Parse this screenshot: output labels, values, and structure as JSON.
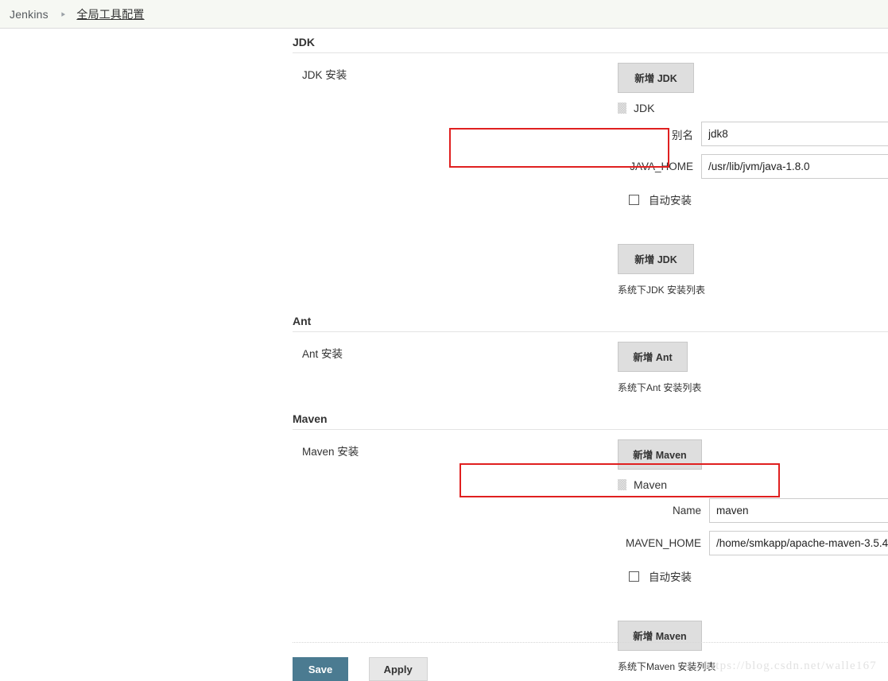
{
  "breadcrumb": {
    "root": "Jenkins",
    "separator": "▸",
    "current": "全局工具配置"
  },
  "sections": {
    "jdk": {
      "title": "JDK",
      "row_label": "JDK 安装",
      "add_button_top": "新增 JDK",
      "tool_name": "JDK",
      "alias_label": "别名",
      "alias_value": "jdk8",
      "home_label": "JAVA_HOME",
      "home_value": "/usr/lib/jvm/java-1.8.0",
      "auto_install_label": "自动安装",
      "add_button_bottom": "新增 JDK",
      "helper_text": "系统下JDK 安装列表"
    },
    "ant": {
      "title": "Ant",
      "row_label": "Ant 安装",
      "add_button": "新增 Ant",
      "helper_text": "系统下Ant 安装列表"
    },
    "maven": {
      "title": "Maven",
      "row_label": "Maven 安装",
      "add_button_top": "新增 Maven",
      "tool_name": "Maven",
      "name_label": "Name",
      "name_value": "maven",
      "home_label": "MAVEN_HOME",
      "home_value": "/home/smkapp/apache-maven-3.5.4",
      "auto_install_label": "自动安装",
      "add_button_bottom": "新增 Maven",
      "helper_text": "系统下Maven 安装列表"
    }
  },
  "footer": {
    "save_label": "Save",
    "apply_label": "Apply"
  },
  "watermark": "https://blog.csdn.net/walle167",
  "colors": {
    "accent": "#4b7b91",
    "annotation": "#e02020",
    "breadcrumb_bg": "#f6f8f3",
    "button_bg": "#dedede"
  }
}
